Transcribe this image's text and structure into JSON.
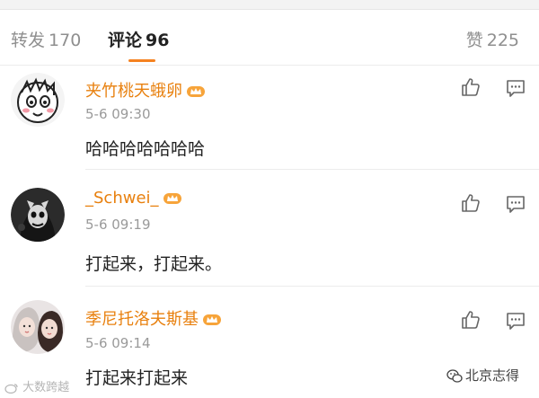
{
  "tabs": {
    "forward": {
      "label": "转发",
      "count": "170"
    },
    "comments": {
      "label": "评论",
      "count": "96"
    },
    "likes": {
      "label": "赞",
      "count": "225"
    }
  },
  "comments": [
    {
      "username": "夹竹桃天蛾卵",
      "time": "5-6 09:30",
      "text": "哈哈哈哈哈哈哈"
    },
    {
      "username": "_Schwei_",
      "time": "5-6 09:19",
      "text": "打起来，打起来。"
    },
    {
      "username": "季尼托洛夫斯基",
      "time": "5-6 09:14",
      "text": "打起来打起来"
    }
  ],
  "watermarks": {
    "left": "大数跨越",
    "right": "北京志得"
  },
  "colors": {
    "accent": "#f58220",
    "username": "#e8800e",
    "muted": "#8f8f8f"
  },
  "icons": [
    "thumbs-up-icon",
    "comment-reply-icon",
    "vip-crown-badge-icon",
    "wechat-logo-icon"
  ]
}
